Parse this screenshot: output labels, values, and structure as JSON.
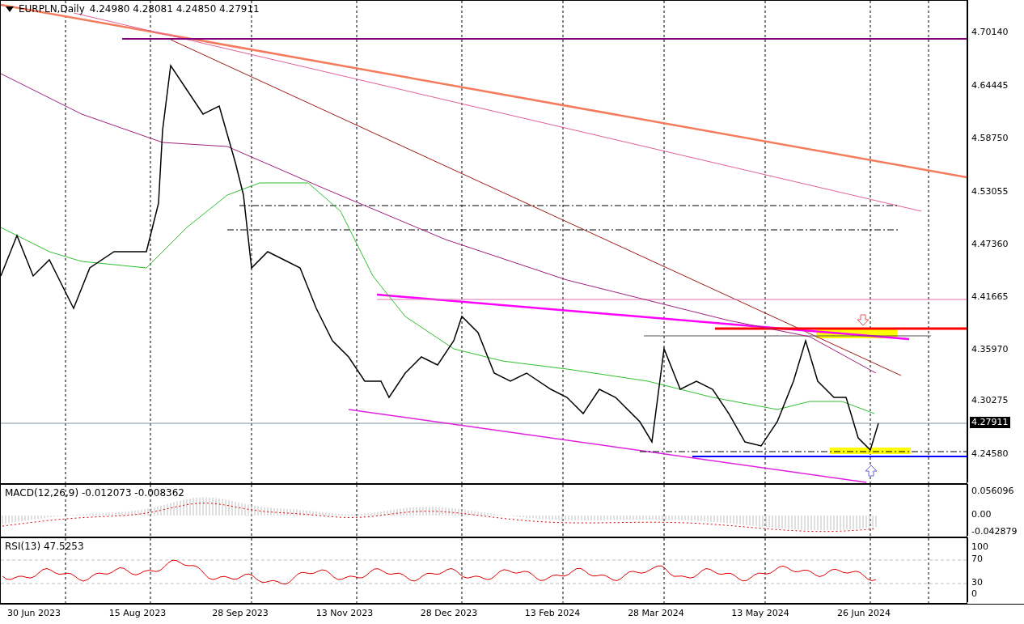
{
  "main_panel": {
    "title": "EURPLN,Daily",
    "ohlc": "4.24980 4.28081 4.24850 4.27911"
  },
  "price_axis": [
    {
      "label": "4.70140",
      "current": false
    },
    {
      "label": "4.64445",
      "current": false
    },
    {
      "label": "4.58750",
      "current": false
    },
    {
      "label": "4.53055",
      "current": false
    },
    {
      "label": "4.47360",
      "current": false
    },
    {
      "label": "4.41665",
      "current": false
    },
    {
      "label": "4.35970",
      "current": false
    },
    {
      "label": "4.30275",
      "current": false
    },
    {
      "label": "4.27911",
      "current": true
    },
    {
      "label": "4.24580",
      "current": false
    }
  ],
  "macd_panel": {
    "title": "MACD(12,26,9) -0.012073 -0.008362",
    "axis": [
      "0.056096",
      "0.00",
      "-0.042879"
    ]
  },
  "rsi_panel": {
    "title": "RSI(13) 47.5253",
    "axis": [
      "100",
      "70",
      "30",
      "0"
    ]
  },
  "date_axis": [
    "30 Jun 2023",
    "15 Aug 2023",
    "28 Sep 2023",
    "13 Nov 2023",
    "28 Dec 2023",
    "13 Feb 2024",
    "28 Mar 2024",
    "13 May 2024",
    "26 Jun 2024"
  ]
}
